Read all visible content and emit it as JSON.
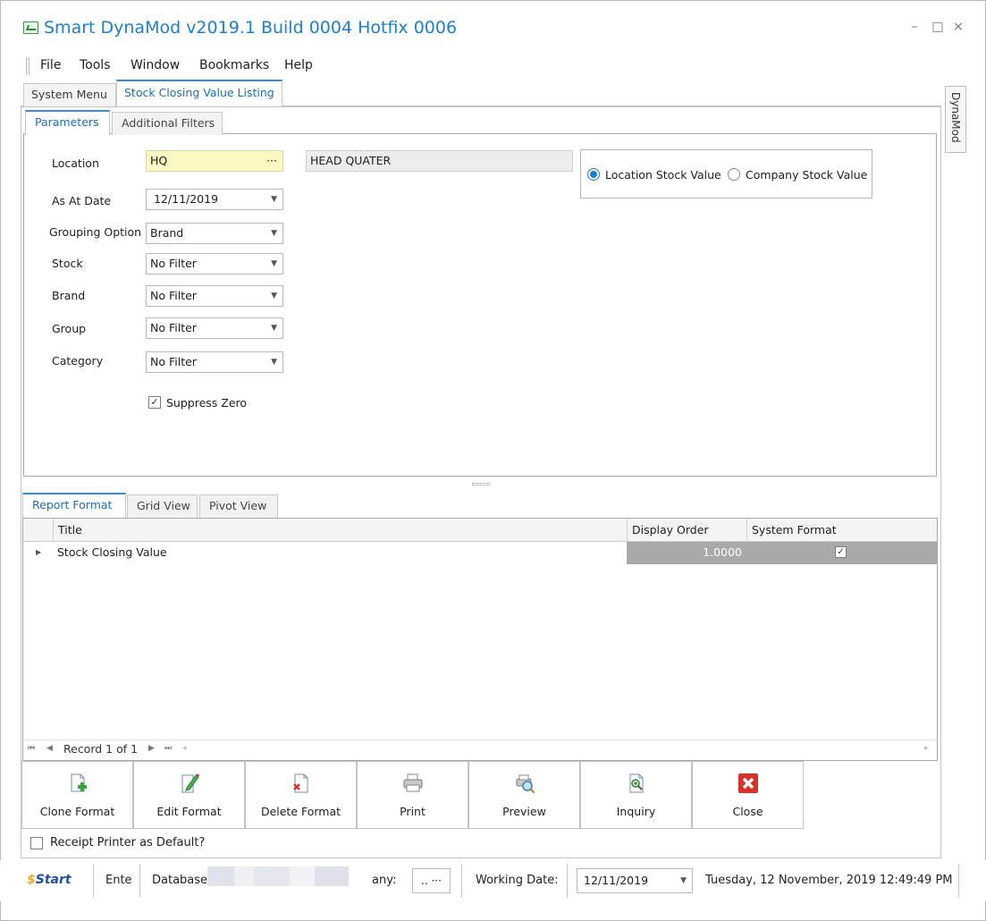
{
  "window": {
    "title": "Smart DynaMod v2019.1 Build 0004 Hotfix 0006",
    "minimize": "–",
    "maximize": "□",
    "close": "×"
  },
  "menu": [
    "File",
    "Tools",
    "Window",
    "Bookmarks",
    "Help"
  ],
  "doc_tabs": [
    "System Menu",
    "Stock Closing Value Listing"
  ],
  "side_tab": "DynaMod",
  "param_tabs": [
    "Parameters",
    "Additional Filters"
  ],
  "params": {
    "location_label": "Location",
    "location_value": "HQ",
    "location_ellipsis": "···",
    "location_desc": "HEAD QUATER",
    "as_at_date_label": "As At Date",
    "as_at_date_value": "12/11/2019",
    "grouping_label": "Grouping Option",
    "grouping_value": "Brand",
    "stock_label": "Stock",
    "stock_value": "No Filter",
    "brand_label": "Brand",
    "brand_value": "No Filter",
    "group_label": "Group",
    "group_value": "No Filter",
    "category_label": "Category",
    "category_value": "No Filter",
    "suppress_zero_label": "Suppress Zero",
    "suppress_zero_checked": true,
    "radio_location": "Location Stock Value",
    "radio_company": "Company Stock Value",
    "radio_selected": "Location Stock Value"
  },
  "report_tabs": [
    "Report Format",
    "Grid View",
    "Pivot View"
  ],
  "grid": {
    "columns": [
      "Title",
      "Display Order",
      "System Format"
    ],
    "rows": [
      {
        "title": "Stock Closing Value",
        "display_order": "1.0000",
        "system_format": true
      }
    ],
    "navigator": "Record 1 of 1"
  },
  "toolbar": [
    {
      "label": "Clone Format",
      "icon": "clone-format-icon"
    },
    {
      "label": "Edit Format",
      "icon": "edit-format-icon"
    },
    {
      "label": "Delete Format",
      "icon": "delete-format-icon"
    },
    {
      "label": "Print",
      "icon": "printer-icon"
    },
    {
      "label": "Preview",
      "icon": "preview-icon"
    },
    {
      "label": "Inquiry",
      "icon": "inquiry-icon"
    },
    {
      "label": "Close",
      "icon": "close-red-icon"
    }
  ],
  "receipt_printer_label": "Receipt Printer as Default?",
  "status_bar": {
    "logo": "Start",
    "ente": "Ente",
    "database_label": "Database:",
    "company_label": "any:",
    "company_btn": ".. ···",
    "working_date_label": "Working Date:",
    "working_date_value": "12/11/2019",
    "datetime": "Tuesday, 12 November, 2019 12:49:49 PM"
  },
  "colors": {
    "accent": "#1c7fd0",
    "highlight_yellow": "#fbf8c1",
    "selected_row": "#a9a9a9",
    "close_red": "#d9322a"
  }
}
